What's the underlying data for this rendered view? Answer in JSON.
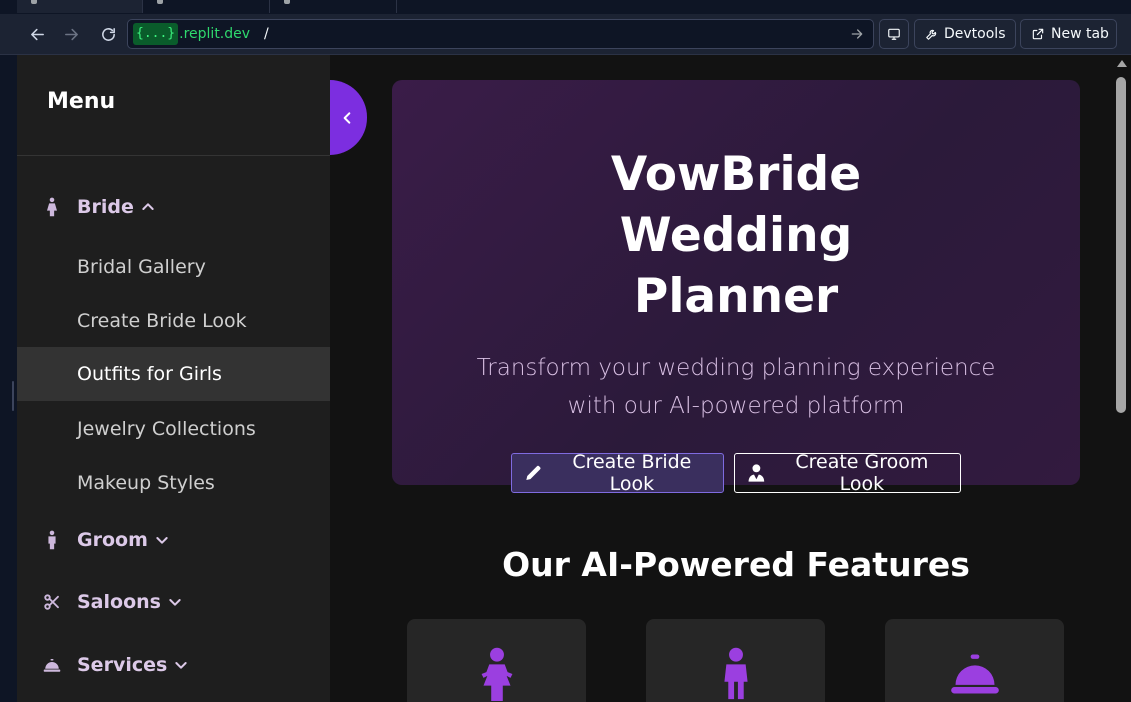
{
  "browser": {
    "tabs": [
      "",
      "",
      ""
    ],
    "url": {
      "host_badge": "{...}",
      "host": ".replit.dev",
      "path": "/"
    },
    "buttons": {
      "devtools": "Devtools",
      "new_tab": "New tab"
    }
  },
  "sidebar": {
    "title": "Menu",
    "sections": [
      {
        "label": "Bride",
        "icon": "female-figure-icon",
        "expanded": true
      },
      {
        "label": "Groom",
        "icon": "male-figure-icon",
        "expanded": false
      },
      {
        "label": "Saloons",
        "icon": "scissors-icon",
        "expanded": false
      },
      {
        "label": "Services",
        "icon": "concierge-bell-icon",
        "expanded": false
      }
    ],
    "bride_items": [
      {
        "label": "Bridal Gallery"
      },
      {
        "label": "Create Bride Look"
      },
      {
        "label": "Outfits for Girls",
        "active": true
      },
      {
        "label": "Jewelry Collections"
      },
      {
        "label": "Makeup Styles"
      }
    ]
  },
  "hero": {
    "title": "VowBride Wedding Planner",
    "subtitle": "Transform your wedding planning experience with our AI-powered platform",
    "actions": {
      "bride": "Create Bride Look",
      "groom": "Create Groom Look"
    }
  },
  "features": {
    "title": "Our AI-Powered Features",
    "cards": [
      {
        "icon": "female-figure-icon"
      },
      {
        "icon": "male-figure-icon"
      },
      {
        "icon": "concierge-bell-icon"
      }
    ]
  },
  "colors": {
    "accent": "#7c2ee0",
    "hero_bg": "#2b1a3a",
    "sidebar_bg": "#1e1e1e",
    "page_bg": "#121212"
  }
}
